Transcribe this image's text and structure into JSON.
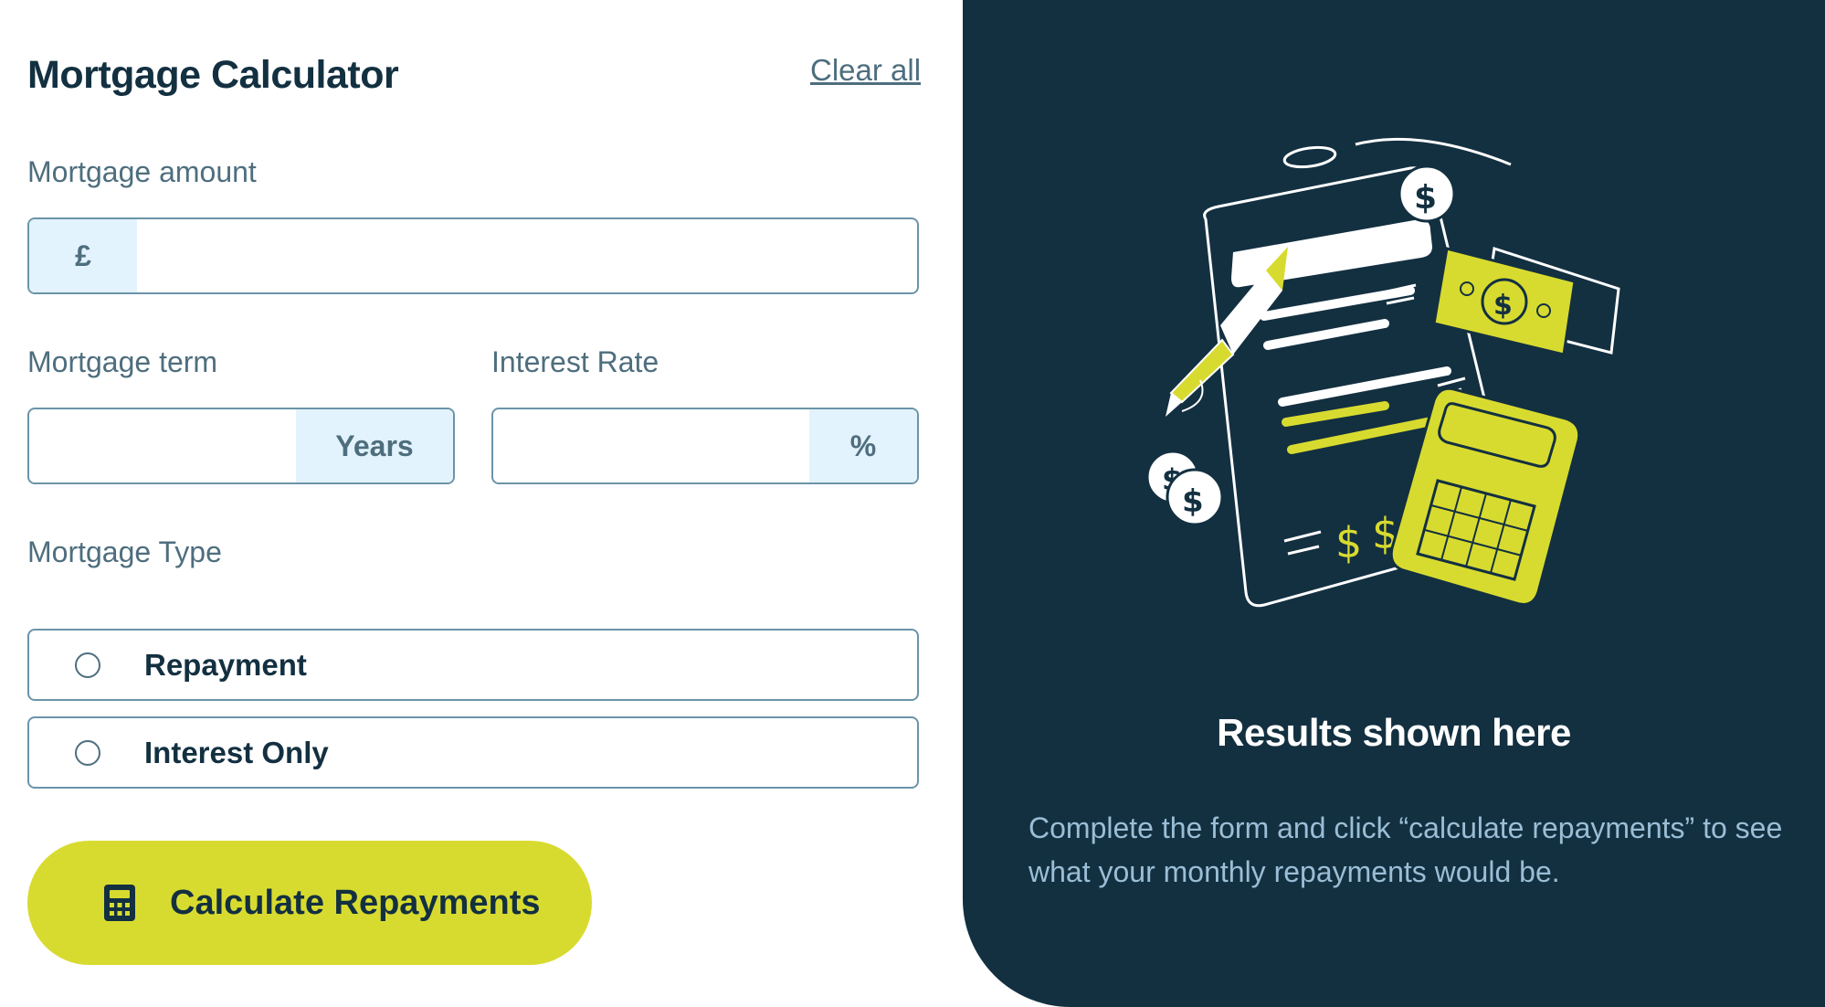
{
  "header": {
    "title": "Mortgage Calculator",
    "clear_all": "Clear all"
  },
  "form": {
    "amount": {
      "label": "Mortgage amount",
      "prefix": "£",
      "value": "",
      "placeholder": ""
    },
    "term": {
      "label": "Mortgage term",
      "suffix": "Years",
      "value": "",
      "placeholder": ""
    },
    "rate": {
      "label": "Interest Rate",
      "suffix": "%",
      "value": "",
      "placeholder": ""
    },
    "type": {
      "label": "Mortgage Type",
      "options": [
        {
          "label": "Repayment",
          "selected": false
        },
        {
          "label": "Interest Only",
          "selected": false
        }
      ]
    },
    "submit_label": "Calculate Repayments"
  },
  "results": {
    "title": "Results shown here",
    "text": "Complete the form and click “calculate repayments” to see what your monthly repayments would be."
  },
  "colors": {
    "navy": "#133041",
    "lime": "#d8db2f",
    "slate": "#4e6e7e",
    "addon_bg": "#e3f3fd",
    "results_text": "#9abed5"
  },
  "icons": {
    "submit": "calculator-icon",
    "illustration": "empty-results-illustration"
  }
}
